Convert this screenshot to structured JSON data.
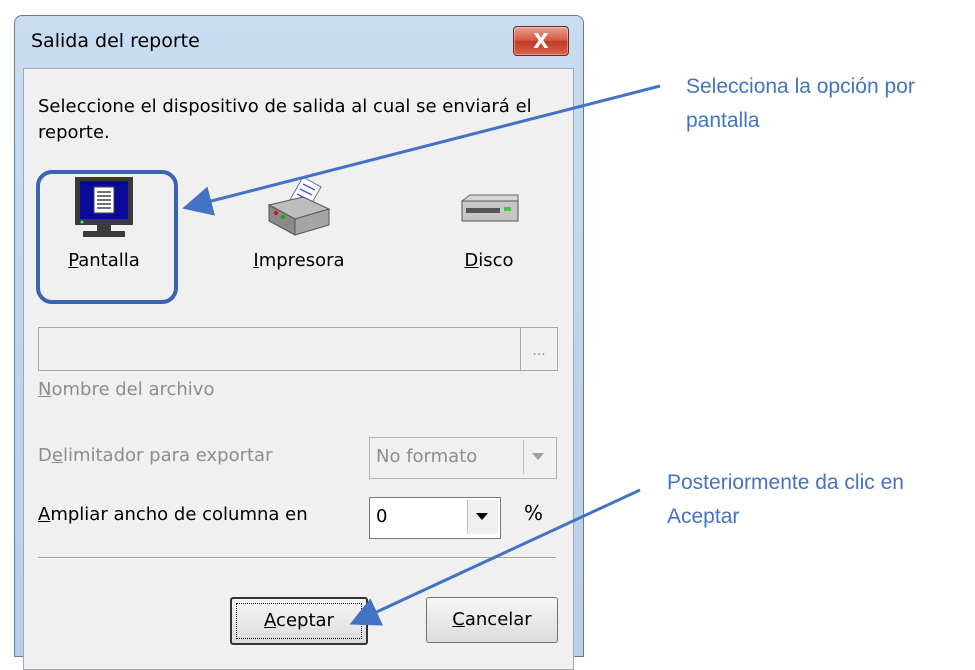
{
  "dialog": {
    "title": "Salida del reporte",
    "close_glyph": "X",
    "instruction": "Seleccione el dispositivo de salida al cual se enviará el reporte.",
    "devices": [
      {
        "pre": "",
        "key": "P",
        "post": "antalla",
        "icon": "monitor-icon"
      },
      {
        "pre": "",
        "key": "I",
        "post": "mpresora",
        "icon": "printer-icon"
      },
      {
        "pre": "",
        "key": "D",
        "post": "isco",
        "icon": "disk-drive-icon"
      }
    ],
    "file": {
      "value": "",
      "browse_label": "...",
      "label_key": "N",
      "label_rest": "ombre del archivo"
    },
    "delimiter": {
      "label_pre": "D",
      "label_key": "e",
      "label_rest": "limitador para exportar",
      "selected": "No formato"
    },
    "widen": {
      "label_key": "A",
      "label_rest": "mpliar ancho de columna en",
      "selected": "0",
      "unit": "%"
    },
    "buttons": {
      "accept_key": "A",
      "accept_rest": "ceptar",
      "cancel_key": "C",
      "cancel_rest": "ancelar"
    }
  },
  "annotations": {
    "note1_line1": "Selecciona la opción por",
    "note1_line2": "pantalla",
    "note2_line1": "Posteriormente da clic en",
    "note2_line2": "Aceptar"
  },
  "colors": {
    "annotation": "#4472c4",
    "highlight_border": "#3a63b5",
    "close_button": "#c9432b"
  }
}
